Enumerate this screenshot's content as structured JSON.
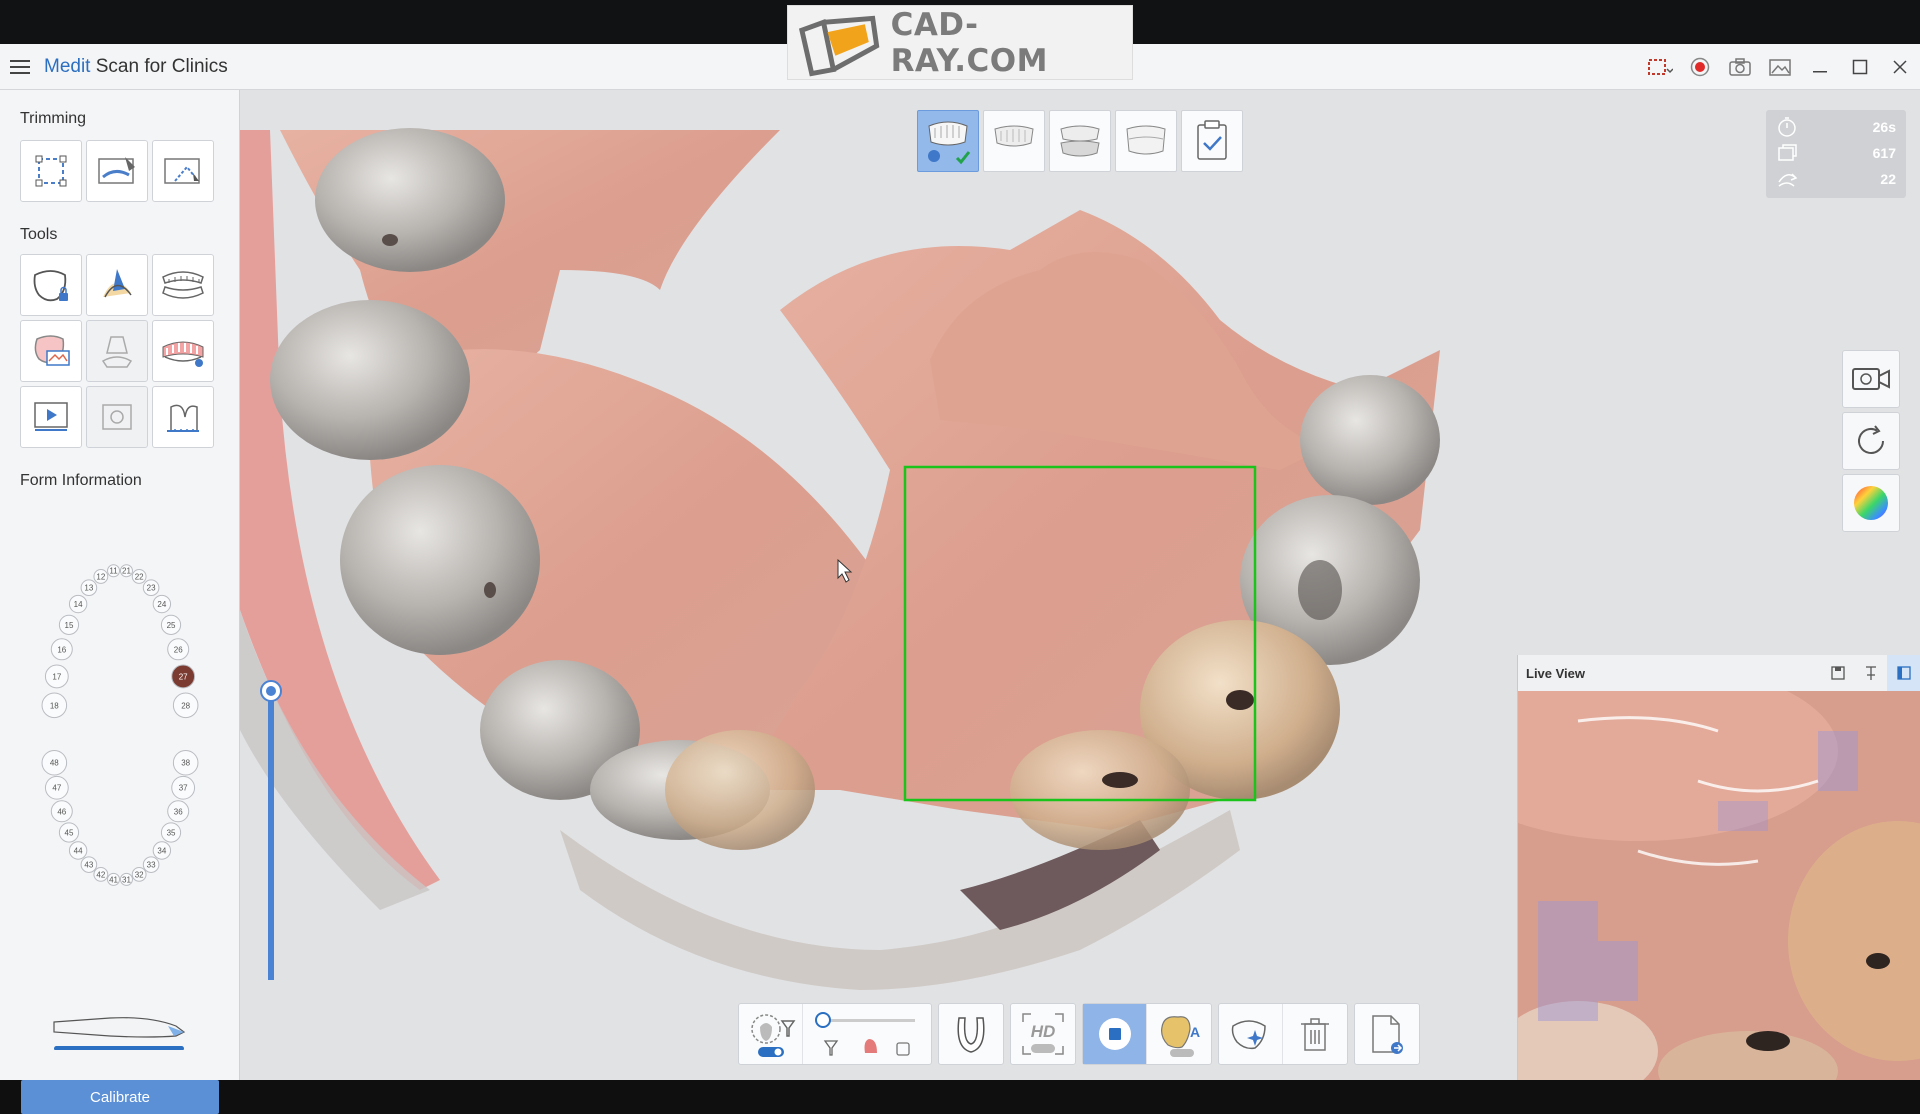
{
  "watermark": {
    "text": "CAD-RAY.COM"
  },
  "app": {
    "title_brand": "Medit",
    "title_rest": " Scan for Clinics"
  },
  "sidebar": {
    "trimming_title": "Trimming",
    "tools_title": "Tools",
    "form_info_title": "Form Information",
    "calibrate_label": "Calibrate"
  },
  "tooth_map": {
    "upper": [
      "11",
      "12",
      "13",
      "14",
      "15",
      "16",
      "17",
      "18",
      "21",
      "22",
      "23",
      "24",
      "25",
      "26",
      "27",
      "28"
    ],
    "lower": [
      "31",
      "32",
      "33",
      "34",
      "35",
      "36",
      "37",
      "38",
      "41",
      "42",
      "43",
      "44",
      "45",
      "46",
      "47",
      "48"
    ],
    "selected": "27"
  },
  "stats": {
    "time": "26s",
    "frames": "617",
    "rotations": "22"
  },
  "liveview": {
    "title": "Live View"
  },
  "colors": {
    "accent": "#2b6fc2",
    "scan_box": "#1bc41b",
    "active_button": "#8fb4e8",
    "record": "#e02a2a"
  }
}
